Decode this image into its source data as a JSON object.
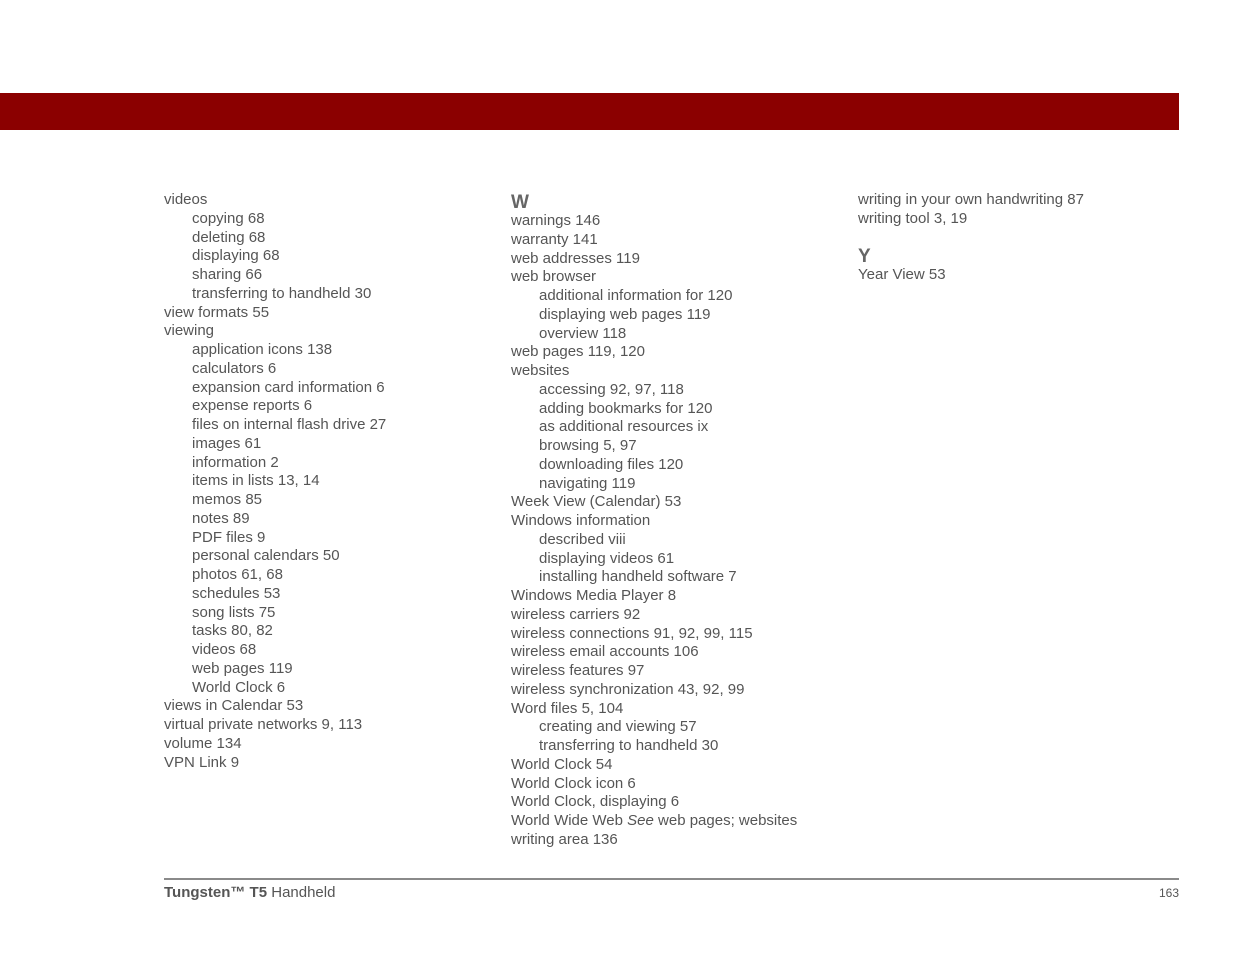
{
  "header": {
    "banner_color": "#8b0000"
  },
  "index": {
    "column1": [
      {
        "text": "videos",
        "level": 0
      },
      {
        "text": "copying 68",
        "level": 1
      },
      {
        "text": "deleting 68",
        "level": 1
      },
      {
        "text": "displaying 68",
        "level": 1
      },
      {
        "text": "sharing 66",
        "level": 1
      },
      {
        "text": "transferring to handheld 30",
        "level": 1
      },
      {
        "text": "view formats 55",
        "level": 0
      },
      {
        "text": "viewing",
        "level": 0
      },
      {
        "text": "application icons 138",
        "level": 1
      },
      {
        "text": "calculators 6",
        "level": 1
      },
      {
        "text": "expansion card information 6",
        "level": 1
      },
      {
        "text": "expense reports 6",
        "level": 1
      },
      {
        "text": "files on internal flash drive 27",
        "level": 1
      },
      {
        "text": "images 61",
        "level": 1
      },
      {
        "text": "information 2",
        "level": 1
      },
      {
        "text": "items in lists 13, 14",
        "level": 1
      },
      {
        "text": "memos 85",
        "level": 1
      },
      {
        "text": "notes 89",
        "level": 1
      },
      {
        "text": "PDF files 9",
        "level": 1
      },
      {
        "text": "personal calendars 50",
        "level": 1
      },
      {
        "text": "photos 61, 68",
        "level": 1
      },
      {
        "text": "schedules 53",
        "level": 1
      },
      {
        "text": "song lists 75",
        "level": 1
      },
      {
        "text": "tasks 80, 82",
        "level": 1
      },
      {
        "text": "videos 68",
        "level": 1
      },
      {
        "text": "web pages 119",
        "level": 1
      },
      {
        "text": "World Clock 6",
        "level": 1
      },
      {
        "text": "views in Calendar 53",
        "level": 0
      },
      {
        "text": "virtual private networks 9, 113",
        "level": 0
      },
      {
        "text": "volume 134",
        "level": 0
      },
      {
        "text": "VPN Link 9",
        "level": 0
      }
    ],
    "column2_letter": "W",
    "column2": [
      {
        "text": "warnings 146",
        "level": 0
      },
      {
        "text": "warranty 141",
        "level": 0
      },
      {
        "text": "web addresses 119",
        "level": 0
      },
      {
        "text": "web browser",
        "level": 0
      },
      {
        "text": "additional information for 120",
        "level": 1
      },
      {
        "text": "displaying web pages 119",
        "level": 1
      },
      {
        "text": "overview 118",
        "level": 1
      },
      {
        "text": "web pages 119, 120",
        "level": 0
      },
      {
        "text": "websites",
        "level": 0
      },
      {
        "text": "accessing 92, 97, 118",
        "level": 1
      },
      {
        "text": "adding bookmarks for 120",
        "level": 1
      },
      {
        "text": "as additional resources ix",
        "level": 1
      },
      {
        "text": "browsing 5, 97",
        "level": 1
      },
      {
        "text": "downloading files 120",
        "level": 1
      },
      {
        "text": "navigating 119",
        "level": 1
      },
      {
        "text": "Week View (Calendar) 53",
        "level": 0
      },
      {
        "text": "Windows information",
        "level": 0
      },
      {
        "text": "described viii",
        "level": 1
      },
      {
        "text": "displaying videos 61",
        "level": 1
      },
      {
        "text": "installing handheld software 7",
        "level": 1
      },
      {
        "text": "Windows Media Player 8",
        "level": 0
      },
      {
        "text": "wireless carriers 92",
        "level": 0
      },
      {
        "text": "wireless connections 91, 92, 99, 115",
        "level": 0
      },
      {
        "text": "wireless email accounts 106",
        "level": 0
      },
      {
        "text": "wireless features 97",
        "level": 0
      },
      {
        "text": "wireless synchronization 43, 92, 99",
        "level": 0
      },
      {
        "text": "Word files 5, 104",
        "level": 0
      },
      {
        "text": "creating and viewing 57",
        "level": 1
      },
      {
        "text": "transferring to handheld 30",
        "level": 1
      },
      {
        "text": "World Clock 54",
        "level": 0
      },
      {
        "text": "World Clock icon 6",
        "level": 0
      },
      {
        "text": "World Clock, displaying 6",
        "level": 0
      }
    ],
    "column2_see_entry": {
      "term": "World Wide Web ",
      "see": "See",
      "target": " web pages; websites"
    },
    "column2_last": "writing area 136",
    "column3_top": [
      {
        "text": "writing in your own handwriting 87",
        "level": 0
      },
      {
        "text": "writing tool 3, 19",
        "level": 0
      }
    ],
    "column3_letter": "Y",
    "column3": [
      {
        "text": "Year View 53",
        "level": 0
      }
    ]
  },
  "footer": {
    "product_bold": "Tungsten™ T5",
    "product_rest": " Handheld",
    "page_number": "163"
  }
}
